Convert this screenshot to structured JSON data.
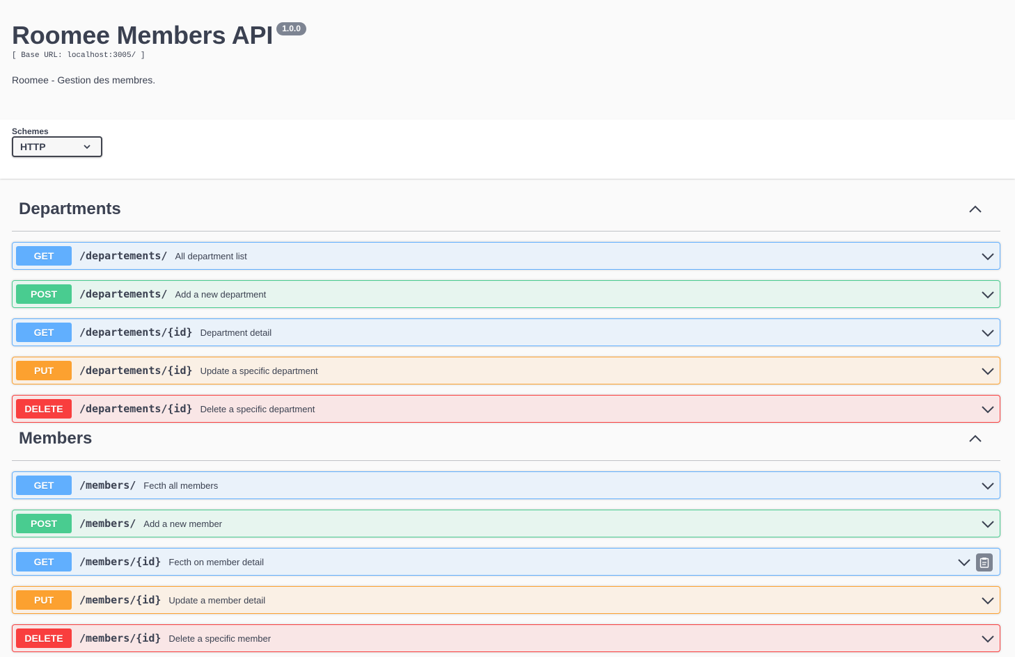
{
  "info": {
    "title": "Roomee Members API",
    "version": "1.0.0",
    "base_url": "[ Base URL: localhost:3005/ ]",
    "description": "Roomee - Gestion des membres."
  },
  "schemes": {
    "label": "Schemes",
    "selected": "HTTP"
  },
  "tags": [
    {
      "name": "Departments",
      "operations": [
        {
          "method": "GET",
          "path": "/departements/",
          "summary": "All department list"
        },
        {
          "method": "POST",
          "path": "/departements/",
          "summary": "Add a new department"
        },
        {
          "method": "GET",
          "path": "/departements/{id}",
          "summary": "Department detail"
        },
        {
          "method": "PUT",
          "path": "/departements/{id}",
          "summary": "Update a specific department"
        },
        {
          "method": "DELETE",
          "path": "/departements/{id}",
          "summary": "Delete a specific department"
        }
      ]
    },
    {
      "name": "Members",
      "operations": [
        {
          "method": "GET",
          "path": "/members/",
          "summary": "Fecth all members"
        },
        {
          "method": "POST",
          "path": "/members/",
          "summary": "Add a new member"
        },
        {
          "method": "GET",
          "path": "/members/{id}",
          "summary": "Fecth on member detail"
        },
        {
          "method": "PUT",
          "path": "/members/{id}",
          "summary": "Update a member detail"
        },
        {
          "method": "DELETE",
          "path": "/members/{id}",
          "summary": "Delete a specific member"
        }
      ]
    }
  ],
  "colors": {
    "get": "#61affe",
    "post": "#49cc90",
    "put": "#fca130",
    "delete": "#f93e3e"
  },
  "icons": {
    "tag_toggle": "chevron-up-icon",
    "op_toggle": "chevron-down-icon",
    "copy": "clipboard-icon"
  }
}
